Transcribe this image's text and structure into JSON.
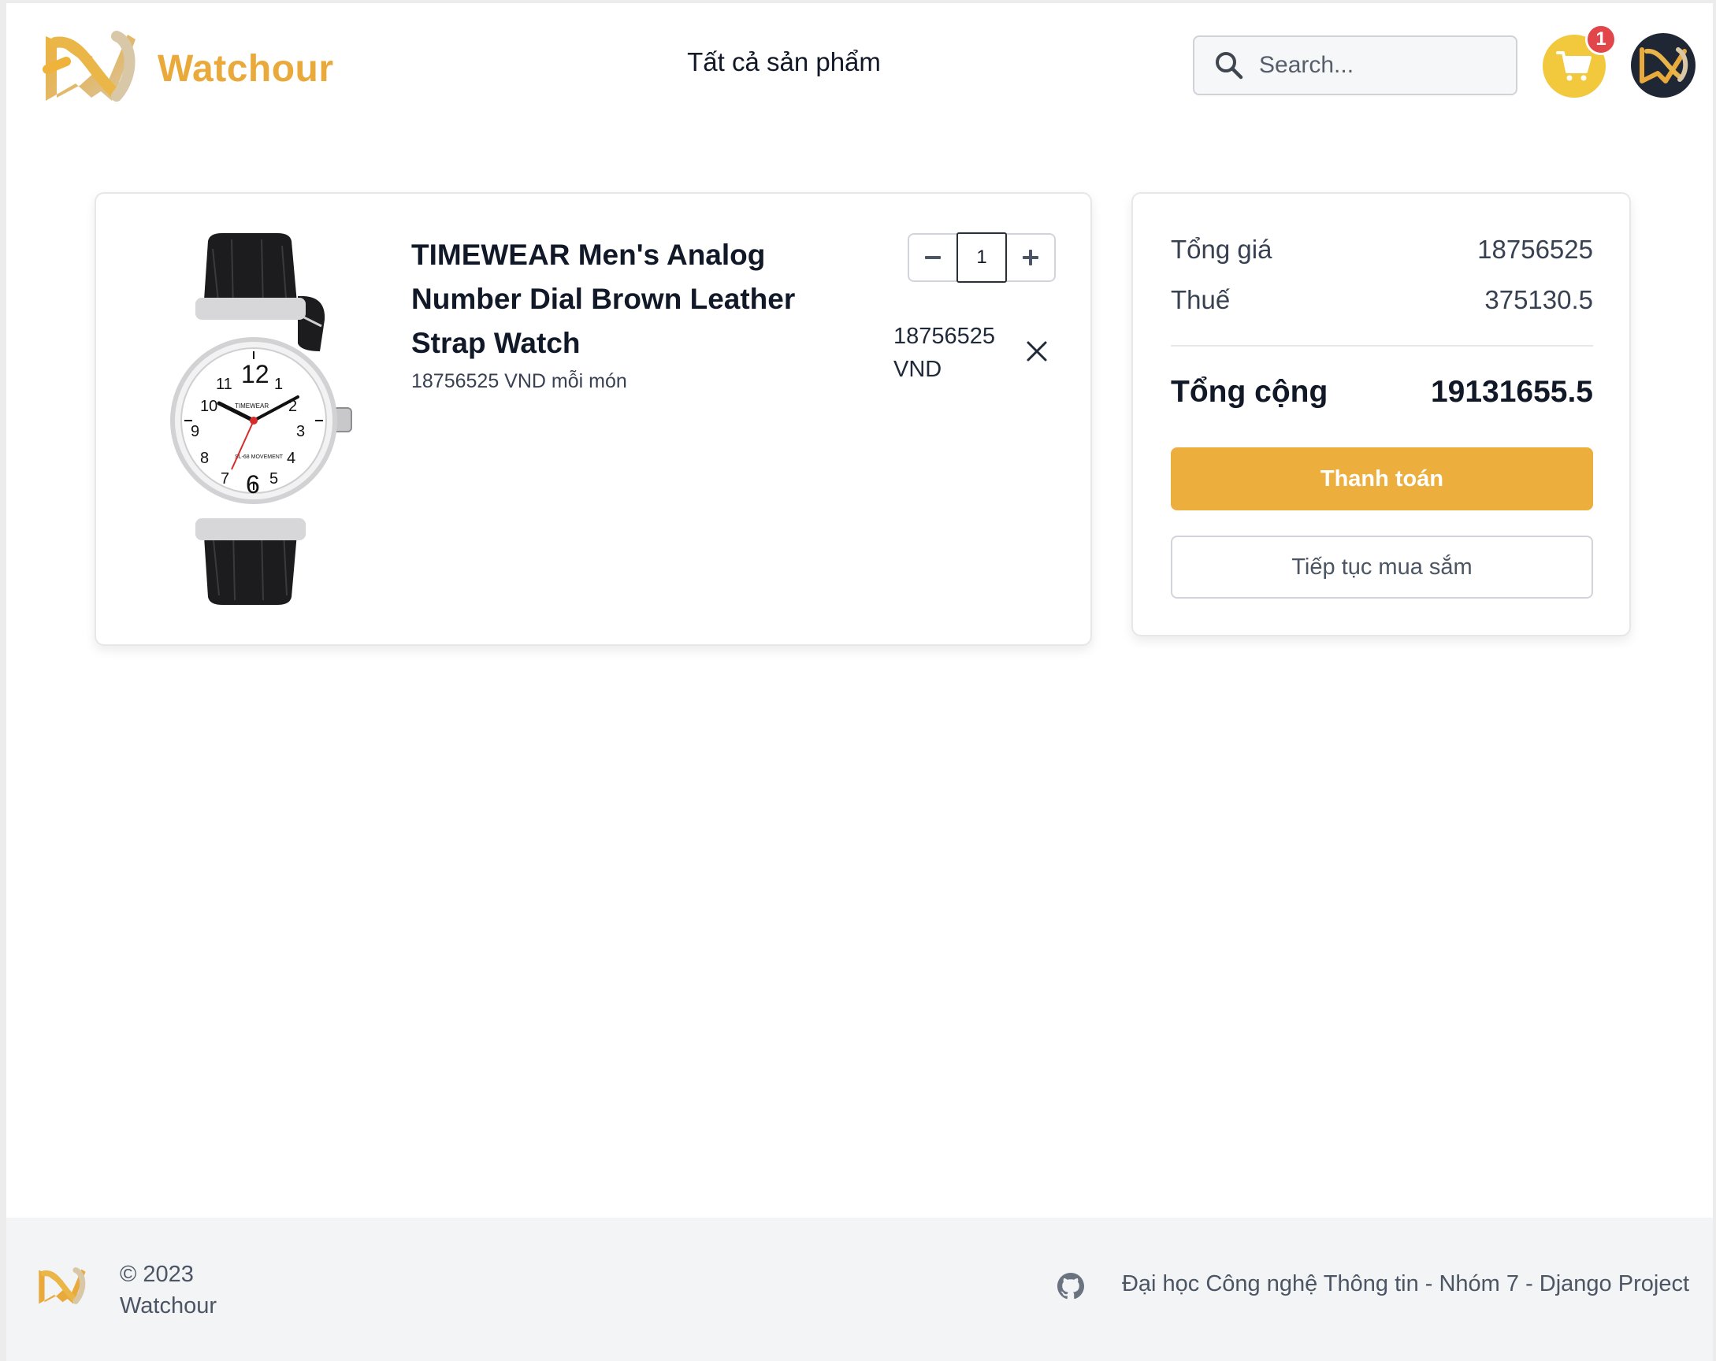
{
  "header": {
    "brand_name": "Watchour",
    "nav_all_products": "Tất cả sản phẩm",
    "search_placeholder": "Search...",
    "cart_count": "1"
  },
  "cart_item": {
    "name": "TIMEWEAR Men's Analog Number Dial Brown Leather Strap Watch",
    "unit_price_text": "18756525 VND mỗi món",
    "quantity": "1",
    "line_total": "18756525",
    "currency": "VND",
    "image_brand_text": "TIMEWEAR",
    "image_movement_text": "SL-68 MOVEMENT"
  },
  "summary": {
    "subtotal_label": "Tổng giá",
    "subtotal_value": "18756525",
    "tax_label": "Thuế",
    "tax_value": "375130.5",
    "total_label": "Tổng cộng",
    "total_value": "19131655.5",
    "checkout_label": "Thanh toán",
    "continue_label": "Tiếp tục mua sắm"
  },
  "footer": {
    "copyright": "© 2023",
    "brand": "Watchour",
    "credit": "Đại học Công nghệ Thông tin - Nhóm 7 - Django Project"
  },
  "colors": {
    "brand_orange": "#e9a93b",
    "checkout_button": "#ecae3d",
    "cart_button": "#f2c83d",
    "badge_red": "#e0464a",
    "avatar_bg": "#1f2735",
    "footer_bg": "#f3f4f6"
  },
  "icons": {
    "logo": "watchour-logo-icon",
    "search": "search-icon",
    "cart": "shopping-cart-icon",
    "minus": "minus-icon",
    "plus": "plus-icon",
    "remove": "close-icon",
    "github": "github-icon"
  }
}
